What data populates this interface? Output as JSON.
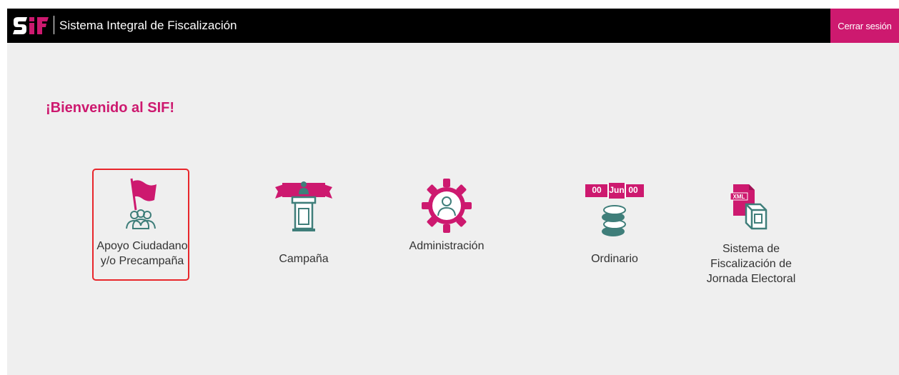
{
  "header": {
    "logo_text": "SIF",
    "title": "Sistema Integral de Fiscalización",
    "logout_label": "Cerrar sesión"
  },
  "welcome": "¡Bienvenido al SIF!",
  "modules": [
    {
      "label_line1": "Apoyo Ciudadano",
      "label_line2": "y/o Precampaña",
      "icon": "flag-people-icon",
      "selected": true
    },
    {
      "label": "Campaña",
      "icon": "podium-icon"
    },
    {
      "label": "Administración",
      "icon": "gear-user-icon"
    },
    {
      "label": "Ordinario",
      "icon": "calendar-coins-icon",
      "calendar": {
        "left": "00",
        "middle": "Jun",
        "right": "00"
      }
    },
    {
      "label_line1": "Sistema de",
      "label_line2": "Fiscalización de",
      "label_line3": "Jornada Electoral",
      "icon": "xml-ballot-box-icon",
      "badge": "XML"
    }
  ],
  "colors": {
    "accent": "#cd196f",
    "teal": "#3f7e7a",
    "selected_border": "#e8262b"
  }
}
